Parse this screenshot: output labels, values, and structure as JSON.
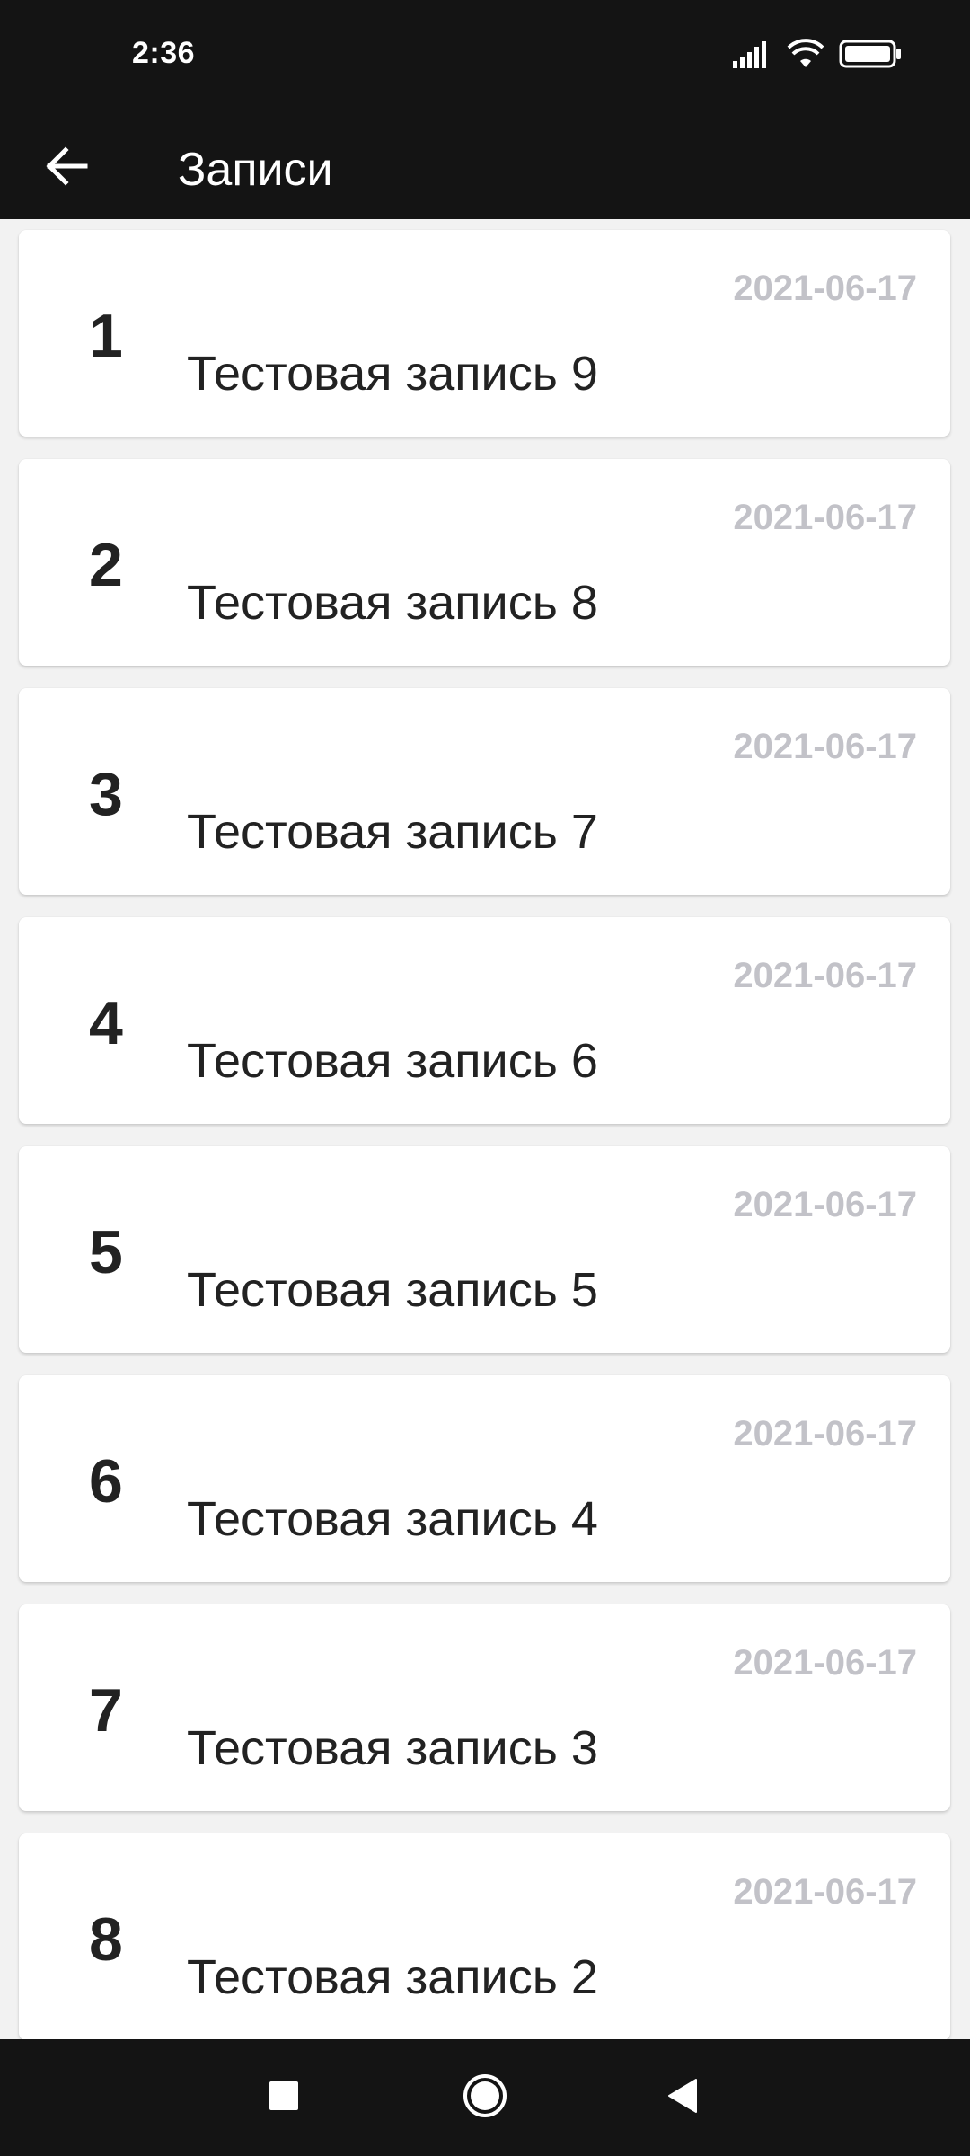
{
  "status_bar": {
    "time": "2:36",
    "icons": [
      "signal-icon",
      "wifi-icon",
      "battery-icon"
    ]
  },
  "app_bar": {
    "title": "Записи",
    "back_icon": "arrow-back-icon"
  },
  "records": [
    {
      "number": "1",
      "date": "2021-06-17",
      "title": "Тестовая запись 9"
    },
    {
      "number": "2",
      "date": "2021-06-17",
      "title": "Тестовая запись 8"
    },
    {
      "number": "3",
      "date": "2021-06-17",
      "title": "Тестовая запись 7"
    },
    {
      "number": "4",
      "date": "2021-06-17",
      "title": "Тестовая запись 6"
    },
    {
      "number": "5",
      "date": "2021-06-17",
      "title": "Тестовая запись 5"
    },
    {
      "number": "6",
      "date": "2021-06-17",
      "title": "Тестовая запись 4"
    },
    {
      "number": "7",
      "date": "2021-06-17",
      "title": "Тестовая запись 3"
    },
    {
      "number": "8",
      "date": "2021-06-17",
      "title": "Тестовая запись 2"
    }
  ],
  "nav_bar": {
    "buttons": [
      "recents-square-icon",
      "home-circle-icon",
      "back-triangle-icon"
    ]
  },
  "colors": {
    "bar_background": "#141414",
    "page_background": "#f2f2f2",
    "card_background": "#ffffff",
    "primary_text": "#222222",
    "date_text": "#c2c2c8"
  }
}
